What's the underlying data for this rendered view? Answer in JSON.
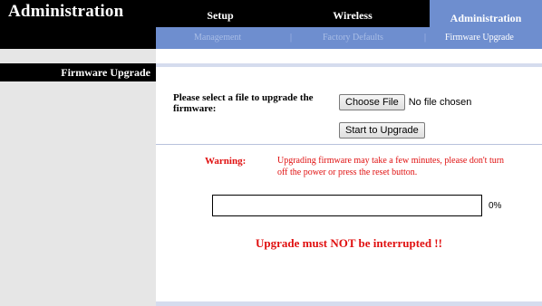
{
  "brand": {
    "title": "Administration"
  },
  "topnav": {
    "items": [
      {
        "label": "Setup",
        "active": false
      },
      {
        "label": "Wireless",
        "active": false
      },
      {
        "label": "Administration",
        "active": true
      }
    ]
  },
  "subnav": {
    "items": [
      {
        "label": "Management",
        "active": false
      },
      {
        "label": "Factory Defaults",
        "active": false
      },
      {
        "label": "Firmware Upgrade",
        "active": true
      }
    ],
    "separator": "|"
  },
  "sidebar": {
    "section_title": "Firmware Upgrade"
  },
  "form": {
    "select_label": "Please select a file to upgrade the firmware:",
    "choose_file_label": "Choose File",
    "no_file_text": "No file chosen",
    "start_upgrade_label": "Start to Upgrade"
  },
  "warning": {
    "label": "Warning:",
    "text": "Upgrading firmware may take a few minutes, please don't turn off the power or press the reset button."
  },
  "progress": {
    "value": 0,
    "label": "0%"
  },
  "notice": "Upgrade must NOT be interrupted !!",
  "colors": {
    "accent_blue": "#6e8ecf",
    "warning_red": "#e01010",
    "header_black": "#000000",
    "sidebar_gray": "#e6e6e6"
  }
}
